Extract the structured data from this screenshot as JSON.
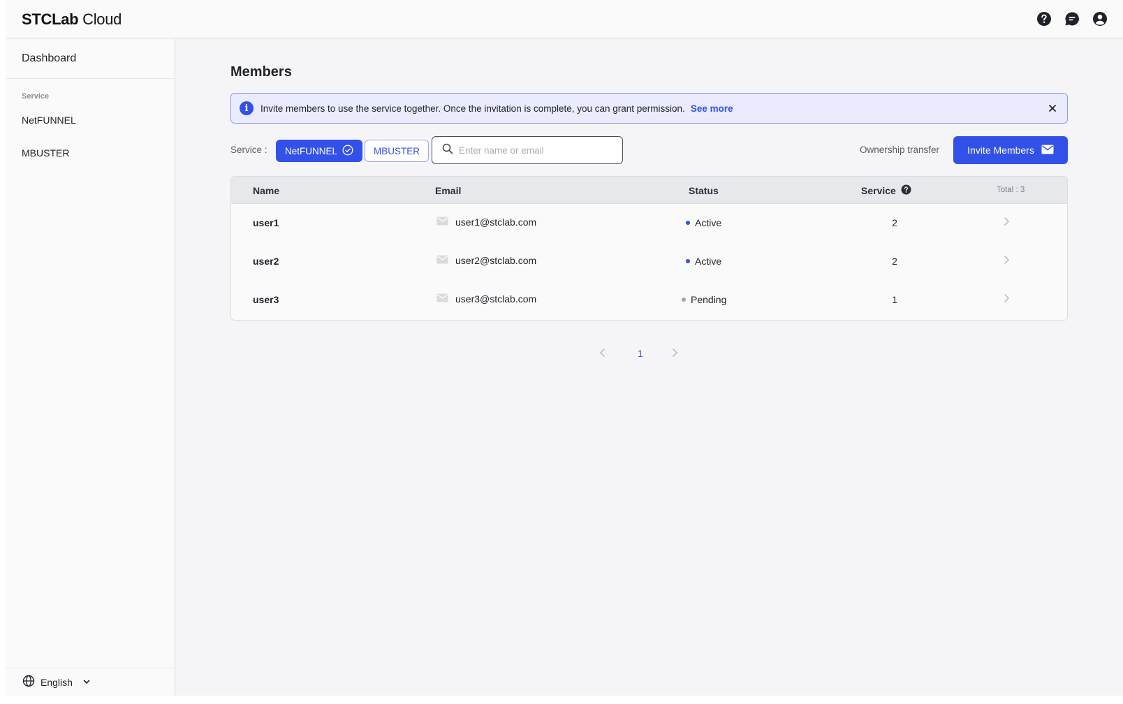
{
  "app": {
    "logo_bold": "STCLab",
    "logo_light": " Cloud"
  },
  "sidebar": {
    "dashboard": "Dashboard",
    "section_label": "Service",
    "items": [
      {
        "label": "NetFUNNEL"
      },
      {
        "label": "MBUSTER"
      }
    ],
    "language": "English"
  },
  "main": {
    "title": "Members",
    "notice": {
      "message": "Invite members to use the service together. Once the invitation is complete, you can grant permission.",
      "link": "See more"
    },
    "filter": {
      "label": "Service :",
      "chips": [
        {
          "label": "NetFUNNEL",
          "selected": true
        },
        {
          "label": "MBUSTER",
          "selected": false
        }
      ],
      "search_placeholder": "Enter name or email",
      "ownership_label": "Ownership transfer",
      "invite_label": "Invite Members"
    },
    "table": {
      "headers": {
        "name": "Name",
        "email": "Email",
        "status": "Status",
        "service": "Service"
      },
      "total": "Total : 3",
      "rows": [
        {
          "name": "user1",
          "email": "user1@stclab.com",
          "status": "Active",
          "service": "2"
        },
        {
          "name": "user2",
          "email": "user2@stclab.com",
          "status": "Active",
          "service": "2"
        },
        {
          "name": "user3",
          "email": "user3@stclab.com",
          "status": "Pending",
          "service": "1"
        }
      ]
    },
    "pagination": {
      "current": "1"
    }
  },
  "colors": {
    "accent": "#3251e8",
    "active_dot": "#3251e8",
    "pending_dot": "#a0a4ab",
    "notice_bg": "#eaecfd"
  },
  "icons": {
    "help": "help-circle-icon",
    "chat": "chat-icon",
    "account": "account-circle-icon",
    "info": "info-icon",
    "close": "close-icon",
    "check": "check-circle-icon",
    "search": "search-icon",
    "mail": "mail-icon",
    "globe": "globe-icon",
    "chevron_down": "chevron-down-icon",
    "chevron_right": "chevron-right-icon",
    "chevron_left": "chevron-left-icon"
  }
}
